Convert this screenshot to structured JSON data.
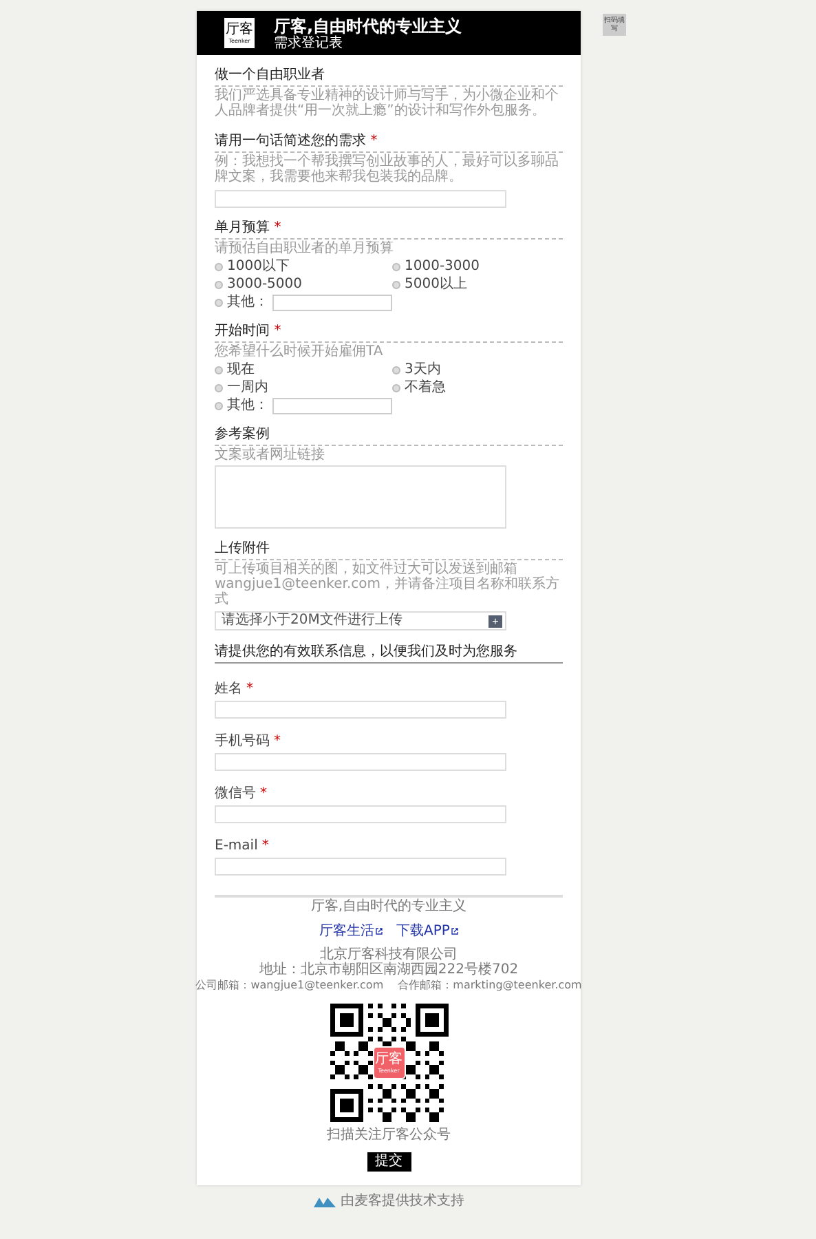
{
  "header": {
    "logo_text": "厅客",
    "logo_subtext": "Teenker",
    "title": "厅客,自由时代的专业主义",
    "subtitle": "需求登记表"
  },
  "side_button": "扫码填写",
  "intro": {
    "title": "做一个自由职业者",
    "description": "我们严选具备专业精神的设计师与写手，为小微企业和个人品牌者提供“用一次就上瘾”的设计和写作外包服务。"
  },
  "questions": [
    {
      "kind": "text",
      "label": "请用一句话简述您的需求",
      "required_mark": "*",
      "description": "例：我想找一个帮我撰写创业故事的人，最好可以多聊品牌文案，我需要他来帮我包装我的品牌。"
    },
    {
      "kind": "radio",
      "label": "单月预算",
      "required_mark": "*",
      "description": "请预估自由职业者的单月预算",
      "options": [
        {
          "label": "1000以下",
          "selected": false
        },
        {
          "label": "1000-3000",
          "selected": false
        },
        {
          "label": "3000-5000",
          "selected": false
        },
        {
          "label": "5000以上",
          "selected": false
        }
      ],
      "other": {
        "label": "其他：",
        "selected": false
      }
    },
    {
      "kind": "radio",
      "label": "开始时间",
      "required_mark": "*",
      "description": "您希望什么时候开始雇佣TA",
      "options": [
        {
          "label": "现在",
          "selected": false
        },
        {
          "label": "3天内",
          "selected": false
        },
        {
          "label": "一周内",
          "selected": false
        },
        {
          "label": "不着急",
          "selected": false
        }
      ],
      "other": {
        "label": "其他：",
        "selected": false
      }
    },
    {
      "kind": "textarea",
      "label": "参考案例",
      "description": "文案或者网址链接"
    },
    {
      "kind": "upload",
      "label": "上传附件",
      "description": "可上传项目相关的图，如文件过大可以发送到邮箱wangjue1@teenker.com，并请备注项目名称和联系方式",
      "placeholder": "请选择小于20M文件进行上传",
      "button": "+"
    }
  ],
  "contact": {
    "heading": "请提供您的有效联系信息，以便我们及时为您服务",
    "fields": [
      {
        "label": "姓名",
        "required_mark": "*"
      },
      {
        "label": "手机号码",
        "required_mark": "*"
      },
      {
        "label": "微信号",
        "required_mark": "*"
      },
      {
        "label": "E-mail",
        "required_mark": "*"
      }
    ]
  },
  "footer": {
    "slogan": "厅客,自由时代的专业主义",
    "links": [
      "厅客生活",
      "下载APP"
    ],
    "company": "北京厅客科技有限公司",
    "address": "地址：北京市朝阳区南湖西园222号楼702",
    "emails": "公司邮箱：wangjue1@teenker.com　 合作邮箱：markting@teenker.com",
    "qr_logo_text": "厅客",
    "qr_logo_subtext": "Teenker",
    "qr_caption": "扫描关注厅客公众号"
  },
  "submit": "提交",
  "powered_by": "由麦客提供技术支持"
}
